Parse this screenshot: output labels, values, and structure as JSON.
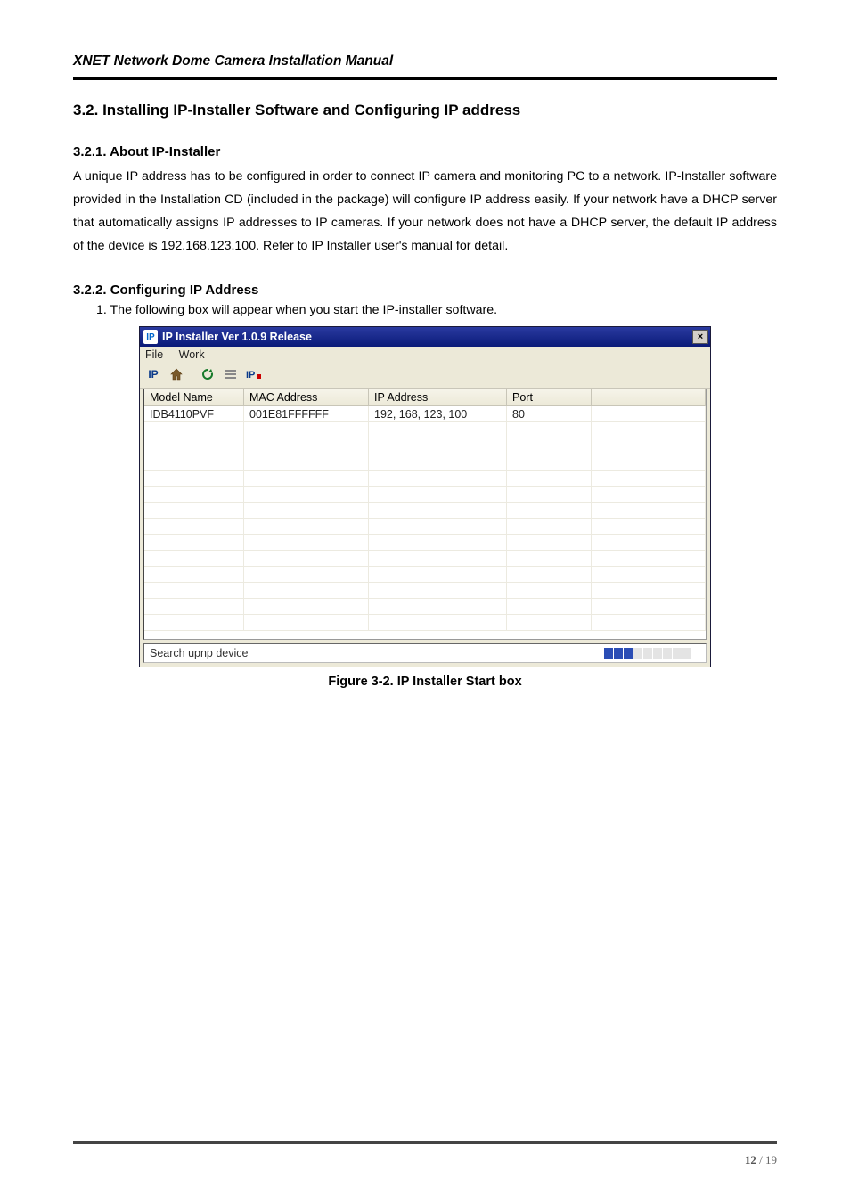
{
  "doc_title": "XNET Network Dome Camera Installation Manual",
  "section_heading": "3.2. Installing IP-Installer Software and Configuring IP address",
  "sub1_heading": "3.2.1. About IP-Installer",
  "sub1_para": "A unique IP address has to be configured in order to connect IP camera and monitoring PC to a network. IP-Installer software provided in the Installation CD (included in the package) will configure IP address easily. If your network have a DHCP server that automatically assigns IP addresses to IP cameras. If your network does not have a DHCP server, the default IP address of the device is 192.168.123.100. Refer to IP Installer user's manual for detail.",
  "sub2_heading": "3.2.2. Configuring IP Address",
  "sub2_step1": "1. The following box will appear when you start the IP-installer software.",
  "figure_caption": "Figure 3-2. IP Installer Start box",
  "window": {
    "title": "IP Installer Ver 1.0.9 Release",
    "close_label": "×",
    "menu": {
      "file": "File",
      "work": "Work"
    },
    "toolbar": {
      "ip_label": "IP",
      "home_icon": "home-icon",
      "refresh_icon": "refresh-icon",
      "list_icon": "list-icon",
      "ipr_icon": "ip-flag-icon"
    },
    "columns": {
      "c1": "Model Name",
      "c2": "MAC Address",
      "c3": "IP Address",
      "c4": "Port",
      "c5": ""
    },
    "rows": [
      {
        "model": "IDB4110PVF",
        "mac": "001E81FFFFFF",
        "ip": "192, 168, 123, 100",
        "port": "80"
      }
    ],
    "blank_rows": 13,
    "status_text": "Search upnp device",
    "progress_segments_on": 3,
    "progress_segments_total": 9
  },
  "footer": {
    "current": "12",
    "sep": " / ",
    "total": "19"
  }
}
